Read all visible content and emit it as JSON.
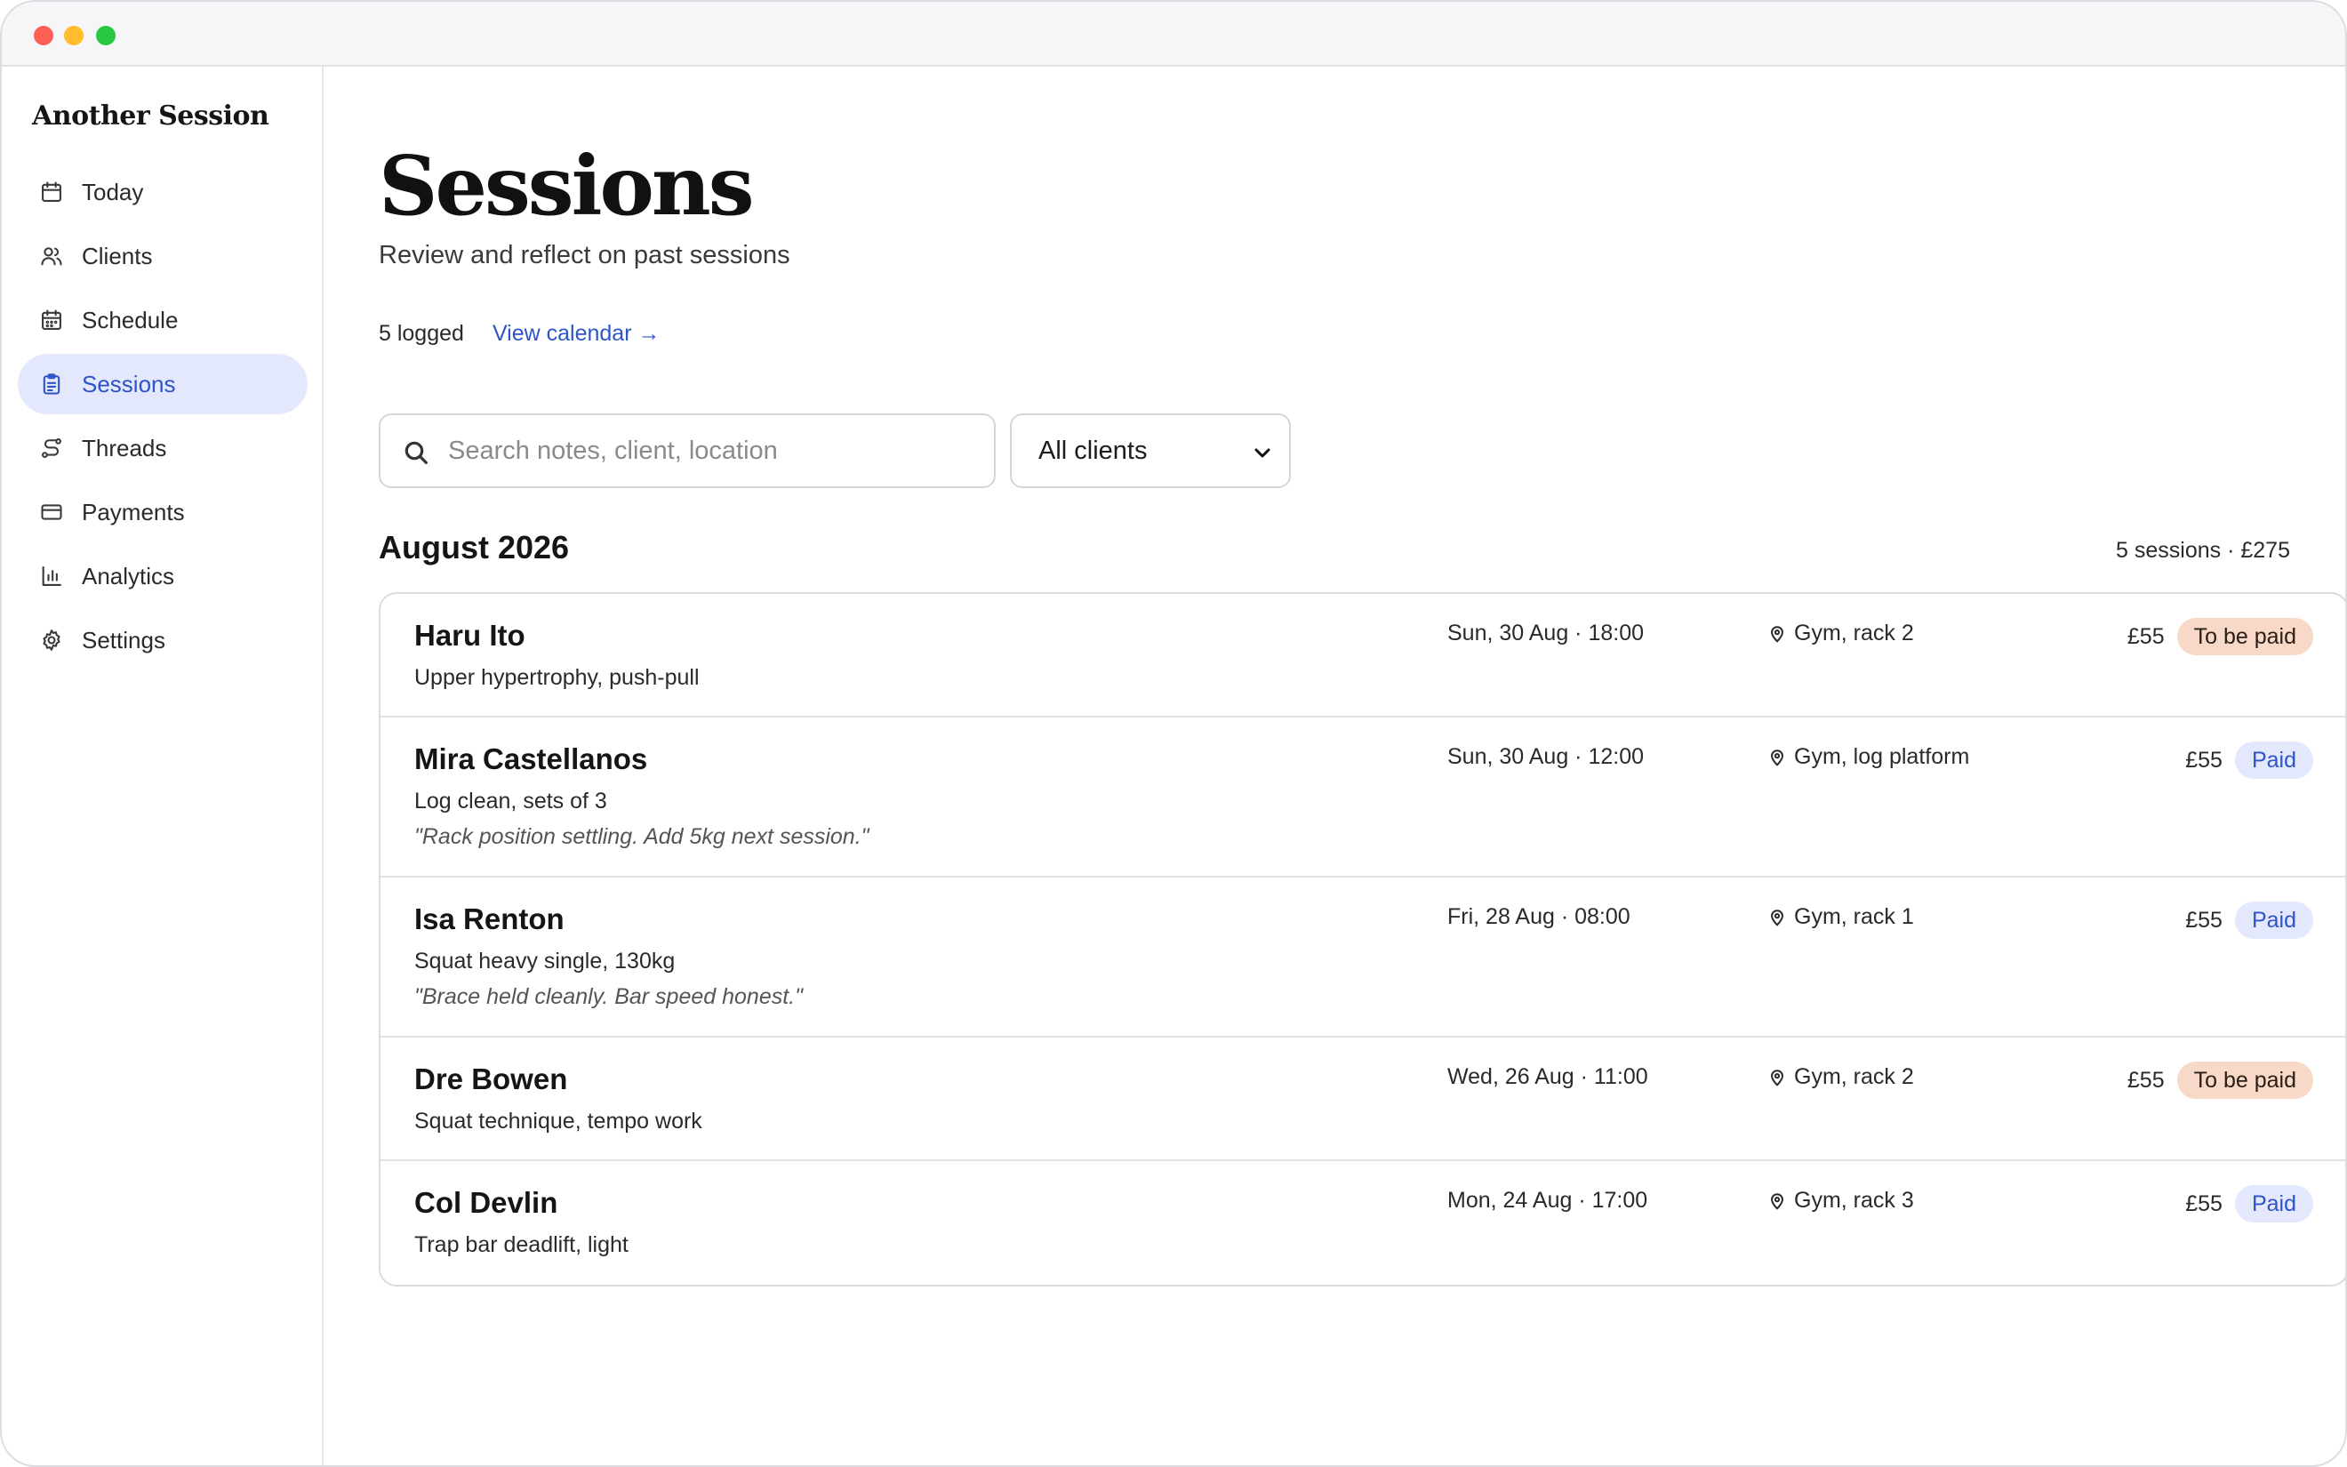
{
  "app": {
    "name": "Another Session"
  },
  "sidebar": {
    "items": [
      {
        "label": "Today",
        "icon": "calendar-icon",
        "active": false
      },
      {
        "label": "Clients",
        "icon": "users-icon",
        "active": false
      },
      {
        "label": "Schedule",
        "icon": "calendar-grid-icon",
        "active": false
      },
      {
        "label": "Sessions",
        "icon": "clipboard-icon",
        "active": true
      },
      {
        "label": "Threads",
        "icon": "route-icon",
        "active": false
      },
      {
        "label": "Payments",
        "icon": "card-icon",
        "active": false
      },
      {
        "label": "Analytics",
        "icon": "bar-chart-icon",
        "active": false
      },
      {
        "label": "Settings",
        "icon": "gear-icon",
        "active": false
      }
    ]
  },
  "page": {
    "title": "Sessions",
    "subtitle": "Review and reflect on past sessions",
    "logged_count": "5 logged",
    "calendar_link": "View calendar →"
  },
  "filters": {
    "search_placeholder": "Search notes, client, location",
    "search_value": "",
    "client_filter": "All clients"
  },
  "month": {
    "title": "August 2026",
    "summary": "5 sessions · £275"
  },
  "sessions": [
    {
      "client": "Haru Ito",
      "description": "Upper hypertrophy, push-pull",
      "note": "",
      "datetime": "Sun, 30 Aug · 18:00",
      "location": "Gym, rack 2",
      "price": "£55",
      "status": "To be paid"
    },
    {
      "client": "Mira Castellanos",
      "description": "Log clean, sets of 3",
      "note": "\"Rack position settling. Add 5kg next session.\"",
      "datetime": "Sun, 30 Aug · 12:00",
      "location": "Gym, log platform",
      "price": "£55",
      "status": "Paid"
    },
    {
      "client": "Isa Renton",
      "description": "Squat heavy single, 130kg",
      "note": "\"Brace held cleanly. Bar speed honest.\"",
      "datetime": "Fri, 28 Aug · 08:00",
      "location": "Gym, rack 1",
      "price": "£55",
      "status": "Paid"
    },
    {
      "client": "Dre Bowen",
      "description": "Squat technique, tempo work",
      "note": "",
      "datetime": "Wed, 26 Aug · 11:00",
      "location": "Gym, rack 2",
      "price": "£55",
      "status": "To be paid"
    },
    {
      "client": "Col Devlin",
      "description": "Trap bar deadlift, light",
      "note": "",
      "datetime": "Mon, 24 Aug · 17:00",
      "location": "Gym, rack 3",
      "price": "£55",
      "status": "Paid"
    }
  ],
  "colors": {
    "accent": "#2e55c7",
    "active_nav_bg": "#e4e8fd",
    "due_badge_bg": "#f8d9c7",
    "paid_badge_bg": "#e4e8fd"
  }
}
